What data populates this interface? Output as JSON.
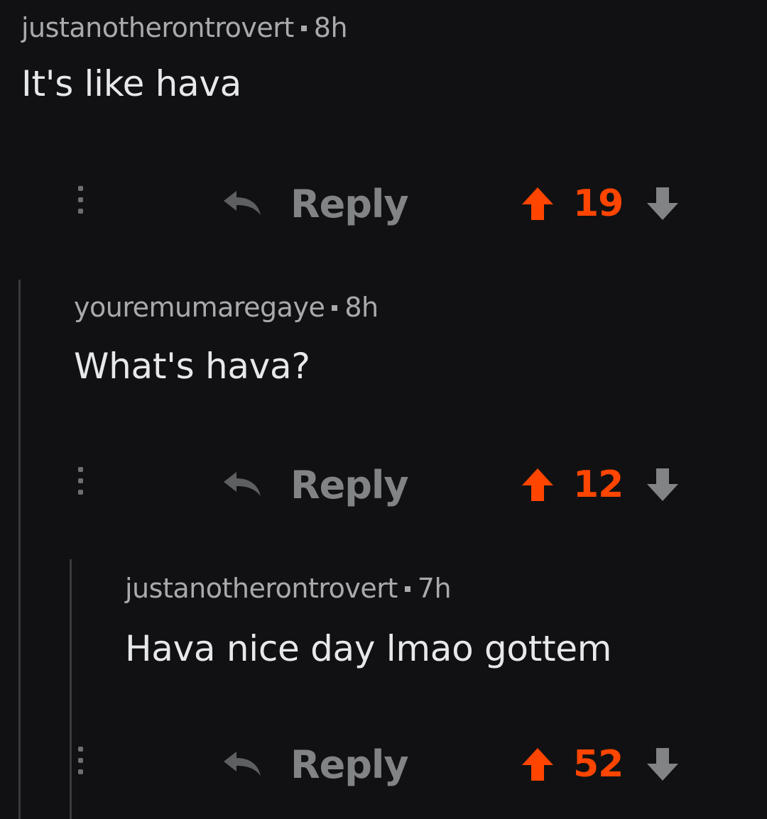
{
  "colors": {
    "background": "#111113",
    "upvote_active": "#ff4500",
    "muted": "#818384",
    "thread_line": "#3a3a3c"
  },
  "comments": [
    {
      "author": "justanotherontrovert",
      "time": "8h",
      "body": "It's like hava",
      "reply_label": "Reply",
      "score": "19",
      "upvoted": true
    },
    {
      "author": "youremumaregaye",
      "time": "8h",
      "body": "What's hava?",
      "reply_label": "Reply",
      "score": "12",
      "upvoted": true
    },
    {
      "author": "justanotherontrovert",
      "time": "7h",
      "body": "Hava nice day lmao gottem",
      "reply_label": "Reply",
      "score": "52",
      "upvoted": true
    }
  ],
  "icons": {
    "more": "more-options-icon",
    "reply": "reply-arrow-icon",
    "upvote": "upvote-arrow-icon",
    "downvote": "downvote-arrow-icon"
  }
}
